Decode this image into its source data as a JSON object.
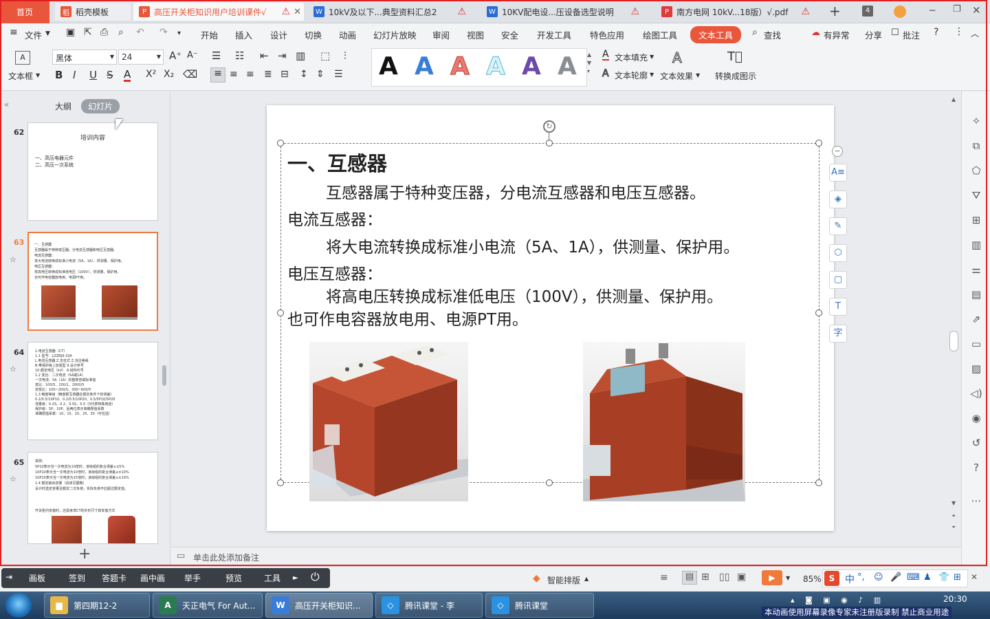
{
  "tabs": [
    {
      "label": "首页",
      "active": true
    },
    {
      "label": "稻壳模板"
    },
    {
      "label": "高压开关柜知识用户培训课件√"
    },
    {
      "label": "10kV及以下...典型资料汇总2"
    },
    {
      "label": "10KV配电设...压设备选型说明"
    },
    {
      "label": "南方电网 10kV...18版）√.pdf"
    }
  ],
  "tab_badge": "4",
  "menu": {
    "file": "文件",
    "items": [
      "开始",
      "插入",
      "设计",
      "切换",
      "动画",
      "幻灯片放映",
      "审阅",
      "视图",
      "安全",
      "开发工具",
      "特色应用",
      "绘图工具",
      "文本工具"
    ],
    "search": "查找",
    "right": [
      "有异常",
      "分享",
      "批注"
    ]
  },
  "ribbon": {
    "textbox_label": "文本框",
    "font_name": "黑体",
    "font_size": "24",
    "text_fill": "文本填充",
    "text_outline": "文本轮廓",
    "text_effect": "文本效果",
    "convert_to_diagram": "转换成图示",
    "style_letter": "A"
  },
  "leftpanel": {
    "tab_outline": "大纲",
    "tab_slides": "幻灯片",
    "thumbs": [
      {
        "num": "62",
        "title": "培训内容",
        "lines": [
          "一、高压电器元件",
          "二、高压一次系统"
        ]
      },
      {
        "num": "63",
        "lines": [
          "一、互感器",
          "  互感器属于特种变压器，分电流互感器和电压互感器。",
          "电流互感器：",
          "  将大电流转换成标准小电流（5A、1A），供测量、保护用。",
          "电压互感器：",
          "  将高电压转换成标准低电压（100V），供测量、保护用。",
          "也可作电容器放电用、电源PT用。"
        ]
      },
      {
        "num": "64",
        "lines": [
          "1.电流互感器（CT）",
          "1.1  型号：LZZBJ9-10A",
          "     L.电流互感器  Z.支柱式  Z.浇注绝缘",
          "     B.带保护级  J.加强型  9.设计序号",
          "     10.额定电压（kV）  A.结构代号",
          "1.2  变比：二次电流（5A或1A）",
          "     一次电流：5A（1A）的整数倍或标准值",
          "     变比：100/5、200/1、2000/5",
          "     双变比：100~200/5、300~600/5",
          "1.3  精度等级（精度即互感器在额定条件下的误差）",
          "     0.2/0.5/10P10、0.2/0.5/10P20、0.5/5P10/5P20",
          "     测量级：0.2S、0.2、0.5S、0.5（S代表特殊用途）",
          "     保护级：5P、10P，后两位表示准确限值系数",
          "     准确限值系数：10、15、20、25、30（可任选）"
        ]
      },
      {
        "num": "65",
        "lines": [
          "举例：",
          "  5P10表示当一次电流为10倍时，该绕组的复合误差≤±5%",
          "  10P10表示当一次电流为10倍时，该绕组的复合误差≤±10%",
          "  10P15表示当一次电流为15倍时，该绕组的复合误差≤±10%",
          "1.4  额定输出容量（具体见图略）",
          "     设计时选定容量及额定二次负荷，实际负荷不应超过额定值。",
          "",
          "开关柜内安装时，还需考虑CT的外形尺寸和安装方式"
        ]
      }
    ],
    "add": "+"
  },
  "slide": {
    "title": "一、互感器",
    "p1": "互感器属于特种变压器，分电流互感器和电压互感器。",
    "h_ct": "电流互感器：",
    "p_ct": "将大电流转换成标准小电流（5A、1A），供测量、保护用。",
    "h_pt": "电压互感器：",
    "p_pt": "将高电压转换成标准低电压（100V），供测量、保护用。",
    "p_last": "也可作电容器放电用、电源PT用。"
  },
  "notes_placeholder": "单击此处添加备注",
  "drawtools": [
    "画板",
    "签到",
    "答题卡",
    "画中画",
    "举手",
    "预览",
    "工具"
  ],
  "status": {
    "smart_layout": "智能排版",
    "zoom": "85%",
    "ime": "中"
  },
  "clock": "20:30",
  "taskbar": [
    {
      "label": "第四期12-2"
    },
    {
      "label": "天正电气 For Aut..."
    },
    {
      "label": "高压开关柜知识..."
    },
    {
      "label": "腾讯课堂 - 李"
    },
    {
      "label": "腾讯课堂"
    }
  ],
  "watermark": "本动画使用屏幕录像专家未注册版录制  禁止商业用途",
  "colors": {
    "accent": "#f07a3c",
    "tab_active": "#e9563b",
    "title_accent": "#e04a2e",
    "taskbar": "#1d3b5c"
  }
}
